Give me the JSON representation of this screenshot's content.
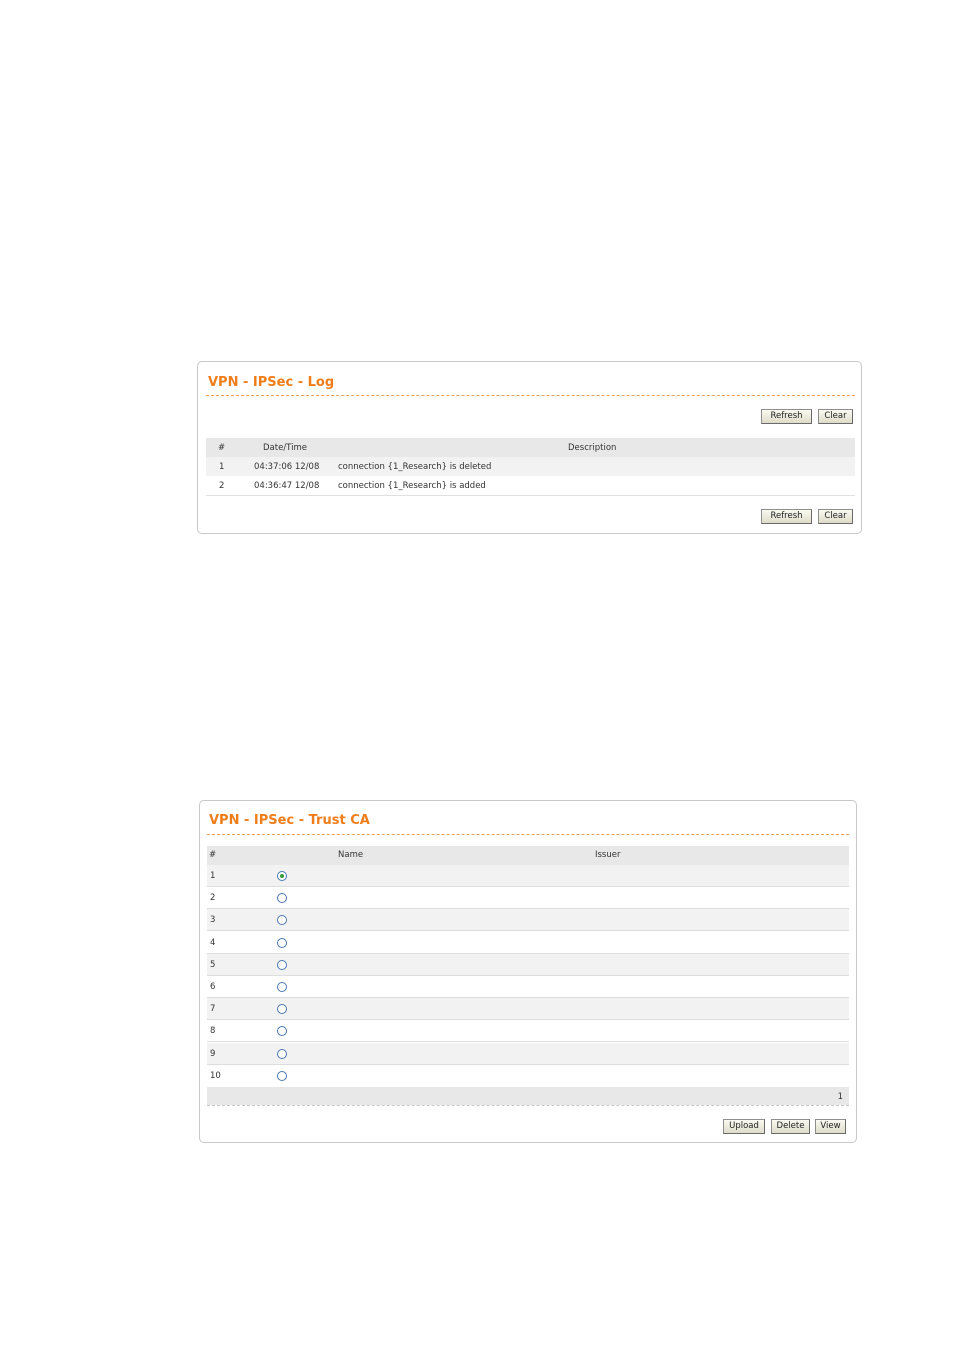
{
  "log_panel": {
    "title": "VPN - IPSec - Log",
    "refresh_label": "Refresh",
    "clear_label": "Clear",
    "columns": {
      "num": "#",
      "datetime": "Date/Time",
      "description": "Description"
    },
    "rows": [
      {
        "num": "1",
        "datetime": "04:37:06 12/08",
        "description": "connection {1_Research} is deleted"
      },
      {
        "num": "2",
        "datetime": "04:36:47 12/08",
        "description": "connection {1_Research} is added"
      }
    ]
  },
  "trust_ca_panel": {
    "title": "VPN - IPSec - Trust CA",
    "columns": {
      "num": "#",
      "name": "Name",
      "issuer": "Issuer"
    },
    "rows": [
      {
        "num": "1",
        "selected": true
      },
      {
        "num": "2",
        "selected": false
      },
      {
        "num": "3",
        "selected": false
      },
      {
        "num": "4",
        "selected": false
      },
      {
        "num": "5",
        "selected": false
      },
      {
        "num": "6",
        "selected": false
      },
      {
        "num": "7",
        "selected": false
      },
      {
        "num": "8",
        "selected": false
      },
      {
        "num": "9",
        "selected": false
      },
      {
        "num": "10",
        "selected": false
      }
    ],
    "page_number": "1",
    "upload_label": "Upload",
    "delete_label": "Delete",
    "view_label": "View"
  },
  "colors": {
    "title_orange": "#f07d1a",
    "header_gray": "#e8e8e8",
    "radio_blue": "#4a78b4",
    "radio_dot_green": "#3a9a3a"
  }
}
